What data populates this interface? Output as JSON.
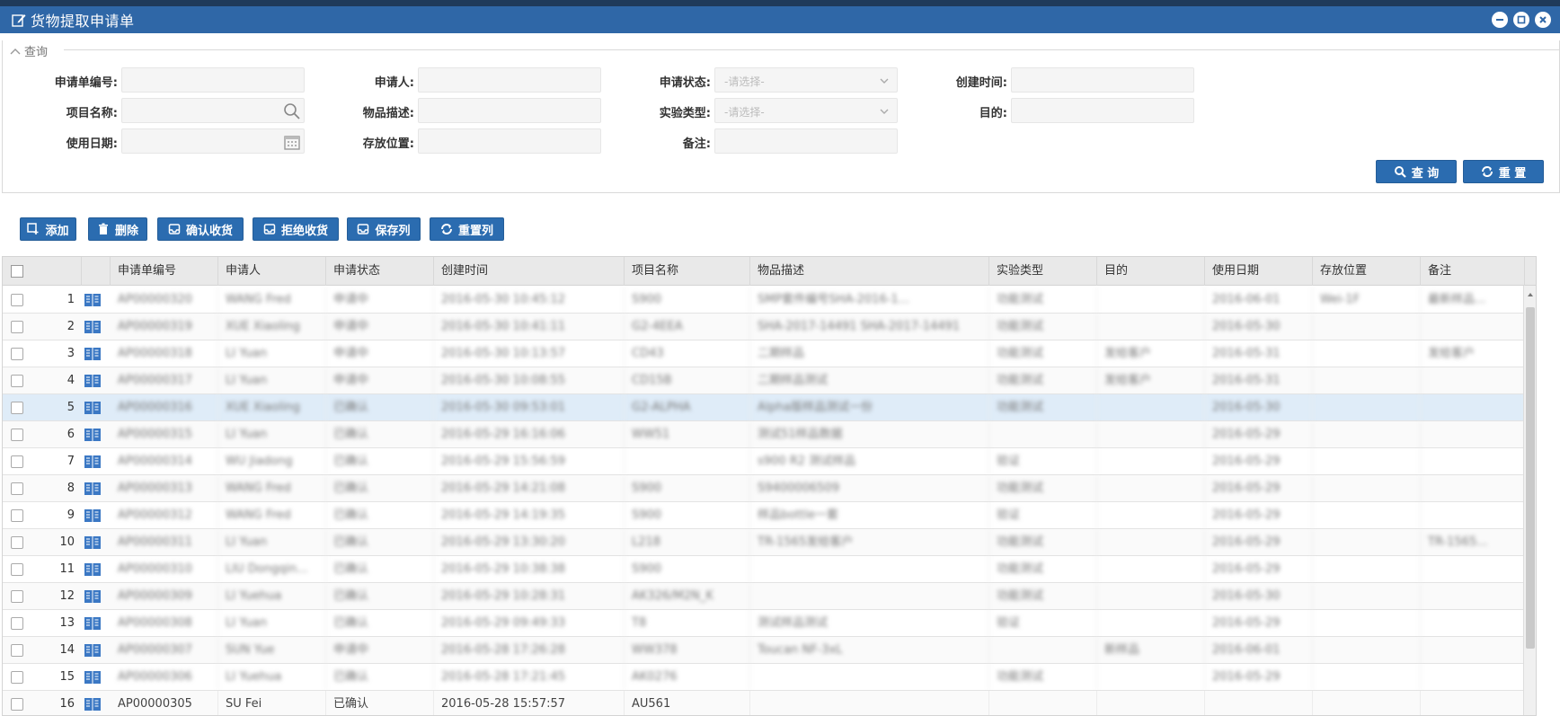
{
  "window": {
    "title": "货物提取申请单"
  },
  "query": {
    "legend": "查询",
    "fields": {
      "app_no": {
        "label": "申请单编号:",
        "value": ""
      },
      "applicant": {
        "label": "申请人:",
        "value": ""
      },
      "status": {
        "label": "申请状态:",
        "placeholder": "-请选择-"
      },
      "created": {
        "label": "创建时间:",
        "value": ""
      },
      "project": {
        "label": "项目名称:",
        "value": ""
      },
      "item_desc": {
        "label": "物品描述:",
        "value": ""
      },
      "exp_type": {
        "label": "实验类型:",
        "placeholder": "-请选择-"
      },
      "purpose": {
        "label": "目的:",
        "value": ""
      },
      "use_date": {
        "label": "使用日期:",
        "value": ""
      },
      "location": {
        "label": "存放位置:",
        "value": ""
      },
      "remark": {
        "label": "备注:",
        "value": ""
      }
    },
    "search_label": "查 询",
    "reset_label": "重 置"
  },
  "toolbar": {
    "add": "添加",
    "delete": "删除",
    "confirm": "确认收货",
    "reject": "拒绝收货",
    "save_cols": "保存列",
    "reset_cols": "重置列"
  },
  "table": {
    "columns": [
      "申请单编号",
      "申请人",
      "申请状态",
      "创建时间",
      "项目名称",
      "物品描述",
      "实验类型",
      "目的",
      "使用日期",
      "存放位置",
      "备注"
    ],
    "rows": [
      {
        "n": "1",
        "c": [
          "AP00000320",
          "WANG Fred",
          "申请中",
          "2016-05-30 10:45:12",
          "S900",
          "SMP套件编号SHA-2016-1...",
          "功能测试",
          "",
          "2016-06-01",
          "Wei-1F",
          "最新样品..."
        ]
      },
      {
        "n": "2",
        "c": [
          "AP00000319",
          "XUE Xiaoling",
          "申请中",
          "2016-05-30 10:41:11",
          "G2-4EEA",
          "SHA-2017-14491 SHA-2017-14491",
          "功能测试",
          "",
          "2016-05-30",
          "",
          ""
        ]
      },
      {
        "n": "3",
        "c": [
          "AP00000318",
          "LI Yuan",
          "申请中",
          "2016-05-30 10:13:57",
          "CD43",
          "二期样品",
          "功能测试",
          "发给客户",
          "2016-05-31",
          "",
          "发给客户"
        ]
      },
      {
        "n": "4",
        "c": [
          "AP00000317",
          "LI Yuan",
          "申请中",
          "2016-05-30 10:08:55",
          "CD15B",
          "二期样品测试",
          "功能测试",
          "发给客户",
          "2016-05-31",
          "",
          ""
        ]
      },
      {
        "n": "5",
        "c": [
          "AP00000316",
          "XUE Xiaoling",
          "已确认",
          "2016-05-30 09:53:01",
          "G2-ALPHA",
          "Alpha版样品测试一份",
          "功能测试",
          "",
          "2016-05-30",
          "",
          ""
        ]
      },
      {
        "n": "6",
        "c": [
          "AP00000315",
          "LI Yuan",
          "已确认",
          "2016-05-29 16:16:06",
          "WW51",
          "测试51样品数据",
          "",
          "",
          "2016-05-29",
          "",
          ""
        ]
      },
      {
        "n": "7",
        "c": [
          "AP00000314",
          "WU Jiadong",
          "已确认",
          "2016-05-29 15:56:59",
          "",
          "s900 R2 测试样品",
          "验证",
          "",
          "2016-05-29",
          "",
          ""
        ]
      },
      {
        "n": "8",
        "c": [
          "AP00000313",
          "WANG Fred",
          "已确认",
          "2016-05-29 14:21:08",
          "S900",
          "S9400006509",
          "功能测试",
          "",
          "2016-05-29",
          "",
          ""
        ]
      },
      {
        "n": "9",
        "c": [
          "AP00000312",
          "WANG Fred",
          "已确认",
          "2016-05-29 14:19:35",
          "S900",
          "样品bottle一套",
          "验证",
          "",
          "2016-05-29",
          "",
          ""
        ]
      },
      {
        "n": "10",
        "c": [
          "AP00000311",
          "LI Yuan",
          "已确认",
          "2016-05-29 13:30:20",
          "L218",
          "TR-1565发给客户",
          "功能测试",
          "",
          "2016-05-29",
          "",
          "TR-1565..."
        ]
      },
      {
        "n": "11",
        "c": [
          "AP00000310",
          "LIU Dongqin...",
          "已确认",
          "2016-05-29 10:38:38",
          "S900",
          "",
          "功能测试",
          "",
          "2016-05-29",
          "",
          ""
        ]
      },
      {
        "n": "12",
        "c": [
          "AP00000309",
          "LI Yuehua",
          "已确认",
          "2016-05-29 10:28:31",
          "AK326/M2N_K",
          "",
          "功能测试",
          "",
          "2016-05-30",
          "",
          ""
        ]
      },
      {
        "n": "13",
        "c": [
          "AP00000308",
          "LI Yuan",
          "已确认",
          "2016-05-29 09:49:33",
          "T8",
          "测试样品测试",
          "验证",
          "",
          "2016-05-29",
          "",
          ""
        ]
      },
      {
        "n": "14",
        "c": [
          "AP00000307",
          "SUN Yue",
          "申请中",
          "2016-05-28 17:26:28",
          "WW378",
          "Toucan NF-3xL",
          "",
          "新样品",
          "2016-06-01",
          "",
          ""
        ]
      },
      {
        "n": "15",
        "c": [
          "AP00000306",
          "LI Yuehua",
          "已确认",
          "2016-05-28 17:21:45",
          "AK0276",
          "",
          "功能测试",
          "",
          "2016-05-29",
          "",
          ""
        ]
      },
      {
        "n": "16",
        "c": [
          "AP00000305",
          "SU Fei",
          "已确认",
          "2016-05-28 15:57:57",
          "AU561",
          "",
          "",
          "",
          "",
          "",
          ""
        ]
      }
    ]
  },
  "colors": {
    "titlebar": "#2f67a7",
    "button": "#2b6cb0",
    "selected_row": "#dfecf8"
  },
  "icons": {
    "title": "edit-icon",
    "search": "search-icon",
    "calendar": "calendar-icon",
    "row_detail": "book-icon"
  }
}
